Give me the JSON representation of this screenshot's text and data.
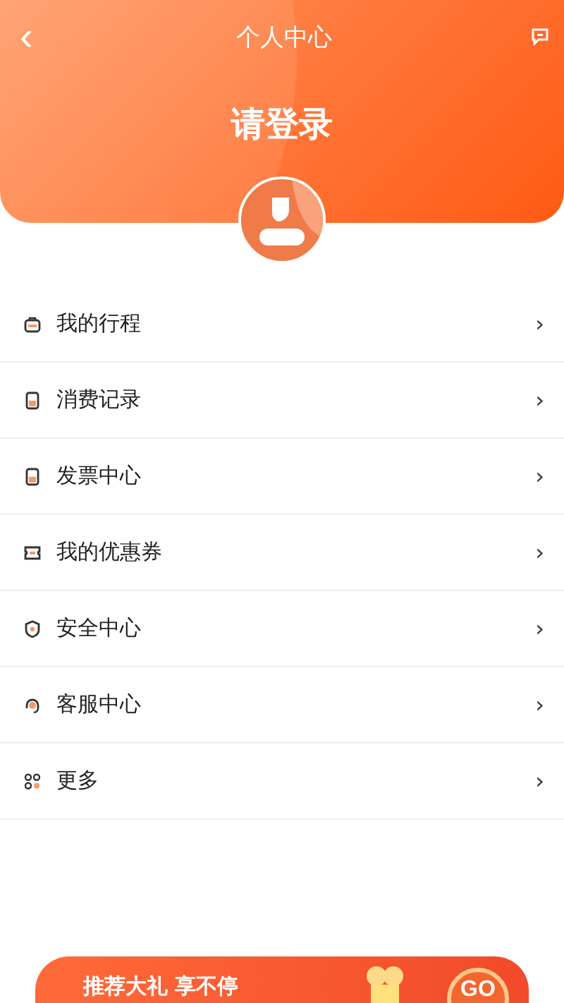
{
  "nav": {
    "back": "‹",
    "title": "个人中心"
  },
  "profile": {
    "login_prompt": "请登录"
  },
  "menu": [
    {
      "kind": "trip",
      "label": "我的行程",
      "chevron": "›"
    },
    {
      "kind": "receipt",
      "label": "消费记录",
      "chevron": "›"
    },
    {
      "kind": "receipt",
      "label": "发票中心",
      "chevron": "›"
    },
    {
      "kind": "coupon",
      "label": "我的优惠券",
      "chevron": "›"
    },
    {
      "kind": "shield",
      "label": "安全中心",
      "chevron": "›"
    },
    {
      "kind": "headset",
      "label": "客服中心",
      "chevron": "›"
    },
    {
      "kind": "grid",
      "label": "更多",
      "chevron": "›"
    }
  ],
  "banner": {
    "text": "推荐大礼 享不停",
    "button": "GO"
  }
}
